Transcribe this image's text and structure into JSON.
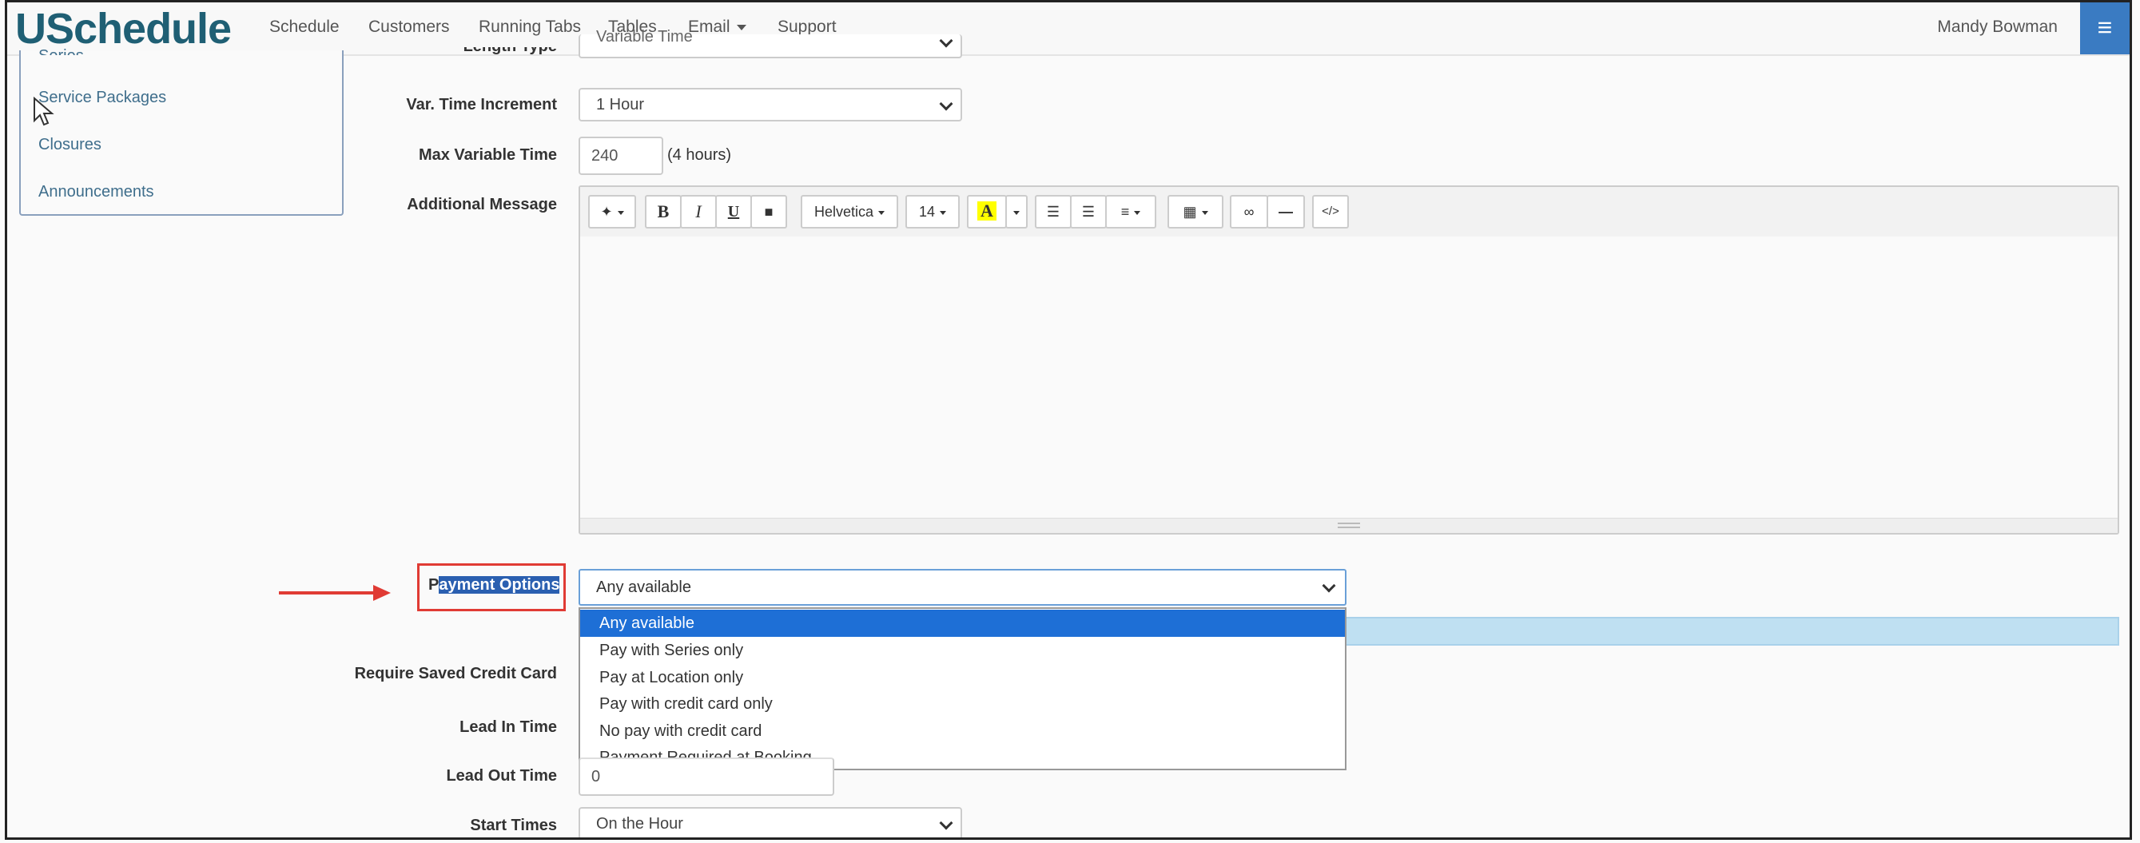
{
  "navbar": {
    "logo": "USchedule",
    "items": [
      "Schedule",
      "Customers",
      "Running Tabs",
      "Tables",
      "Email",
      "Support"
    ],
    "user": "Mandy Bowman",
    "menu_icon": "hamburger-menu-icon"
  },
  "sidebar": {
    "cut_item": "Series",
    "items": [
      "Service Packages",
      "Closures",
      "Announcements"
    ]
  },
  "form": {
    "length_type_label": "Length Type",
    "length_type_value": "Variable Time",
    "var_time_label": "Var. Time Increment",
    "var_time_value": "1 Hour",
    "max_var_label": "Max Variable Time",
    "max_var_value": "240",
    "max_var_hint": "(4 hours)",
    "additional_message_label": "Additional Message",
    "payment_label_prefix": "P",
    "payment_label_selected": "ayment Options",
    "payment_value": "Any available",
    "payment_options": [
      "Any available",
      "Pay with Series only",
      "Pay at Location only",
      "Pay with credit card only",
      "No pay with credit card",
      "Payment Required at Booking"
    ],
    "require_card_label": "Require Saved Credit Card",
    "lead_in_label": "Lead In Time",
    "lead_out_label": "Lead Out Time",
    "lead_out_value": "0",
    "start_times_label": "Start Times",
    "start_times_value": "On the Hour"
  },
  "editor_toolbar": {
    "font_name": "Helvetica",
    "font_size": "14",
    "bold": "B",
    "italic": "I",
    "underline": "U",
    "color": "A",
    "hr": "—",
    "code": "</>"
  }
}
